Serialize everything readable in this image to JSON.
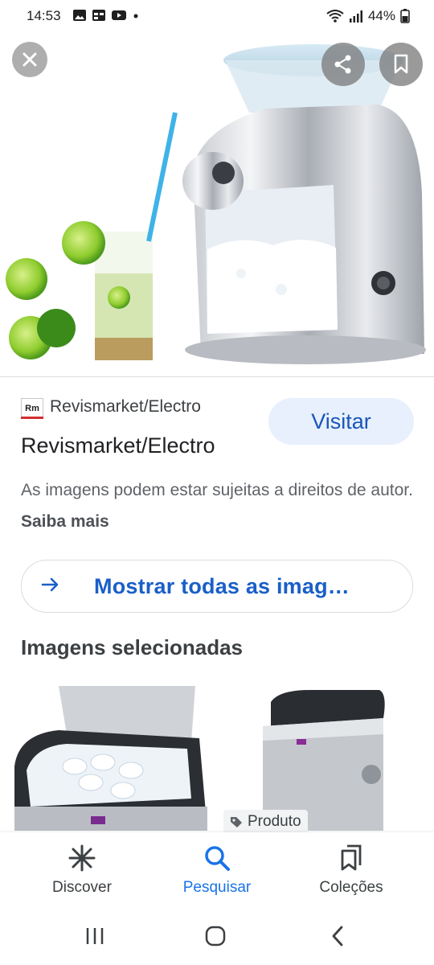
{
  "status": {
    "time": "14:53",
    "battery": "44%"
  },
  "viewer": {
    "close_icon": "close-icon",
    "share_icon": "share-icon",
    "bookmark_icon": "bookmark-icon"
  },
  "source": {
    "logo_text": "Rm",
    "site": "Revismarket/Electro",
    "visit_label": "Visitar",
    "title": "Revismarket/Electro",
    "copyright_text": "As imagens podem estar sujeitas a direitos de autor.",
    "learn_more": "Saiba mais"
  },
  "show_all": {
    "label": "Mostrar todas as imag…"
  },
  "related": {
    "title": "Imagens selecionadas",
    "chip_label": "Produto"
  },
  "bottom_nav": {
    "items": [
      {
        "label": "Discover",
        "icon": "asterisk-icon"
      },
      {
        "label": "Pesquisar",
        "icon": "search-icon"
      },
      {
        "label": "Coleções",
        "icon": "collections-icon"
      }
    ],
    "active_color": "#1a73e8",
    "inactive_color": "#3c4043"
  }
}
